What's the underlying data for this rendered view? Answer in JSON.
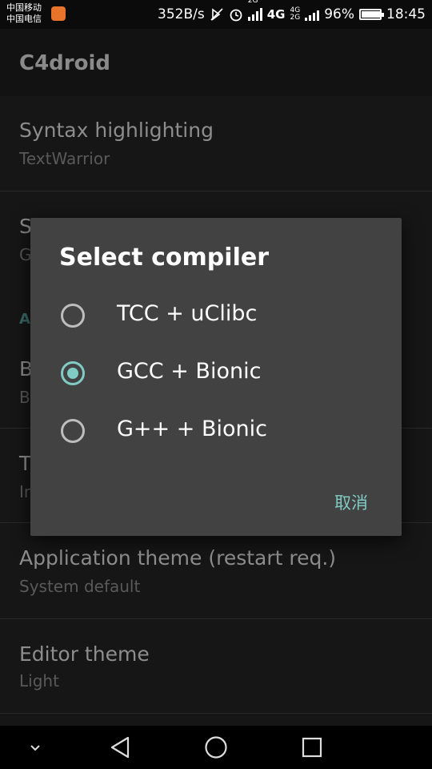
{
  "status_bar": {
    "carrier_1": "中国移动",
    "carrier_2": "中国电信",
    "net_speed": "352B/s",
    "net_2g": "2G",
    "net_4g": "4G",
    "net_4g_small": "4G",
    "net_2g_small": "2G",
    "battery_percent": "96%",
    "battery_level": 0.96,
    "time": "18:45"
  },
  "app_bar": {
    "title": "C4droid"
  },
  "settings": {
    "syntax_title": "Syntax highlighting",
    "syntax_value": "TextWarrior",
    "compiler_title_partial": "S",
    "compiler_value_partial": "G",
    "category_partial": "A",
    "item3_title_partial": "B",
    "item3_sub_partial": "B",
    "item4_title_partial": "T",
    "item4_sub_partial": "In",
    "theme_title": "Application theme (restart req.)",
    "theme_value": "System default",
    "editor_theme_title": "Editor theme",
    "editor_theme_value": "Light"
  },
  "dialog": {
    "title": "Select compiler",
    "options": [
      {
        "label": "TCC + uClibc",
        "checked": false
      },
      {
        "label": "GCC + Bionic",
        "checked": true
      },
      {
        "label": "G++ + Bionic",
        "checked": false
      }
    ],
    "cancel_label": "取消"
  },
  "colors": {
    "accent": "#80cbc4",
    "dialog_bg": "#424242",
    "background": "#161616"
  },
  "nav_bar": {
    "icons": [
      "chevron-down-icon",
      "back-icon",
      "home-icon",
      "recents-icon"
    ]
  }
}
